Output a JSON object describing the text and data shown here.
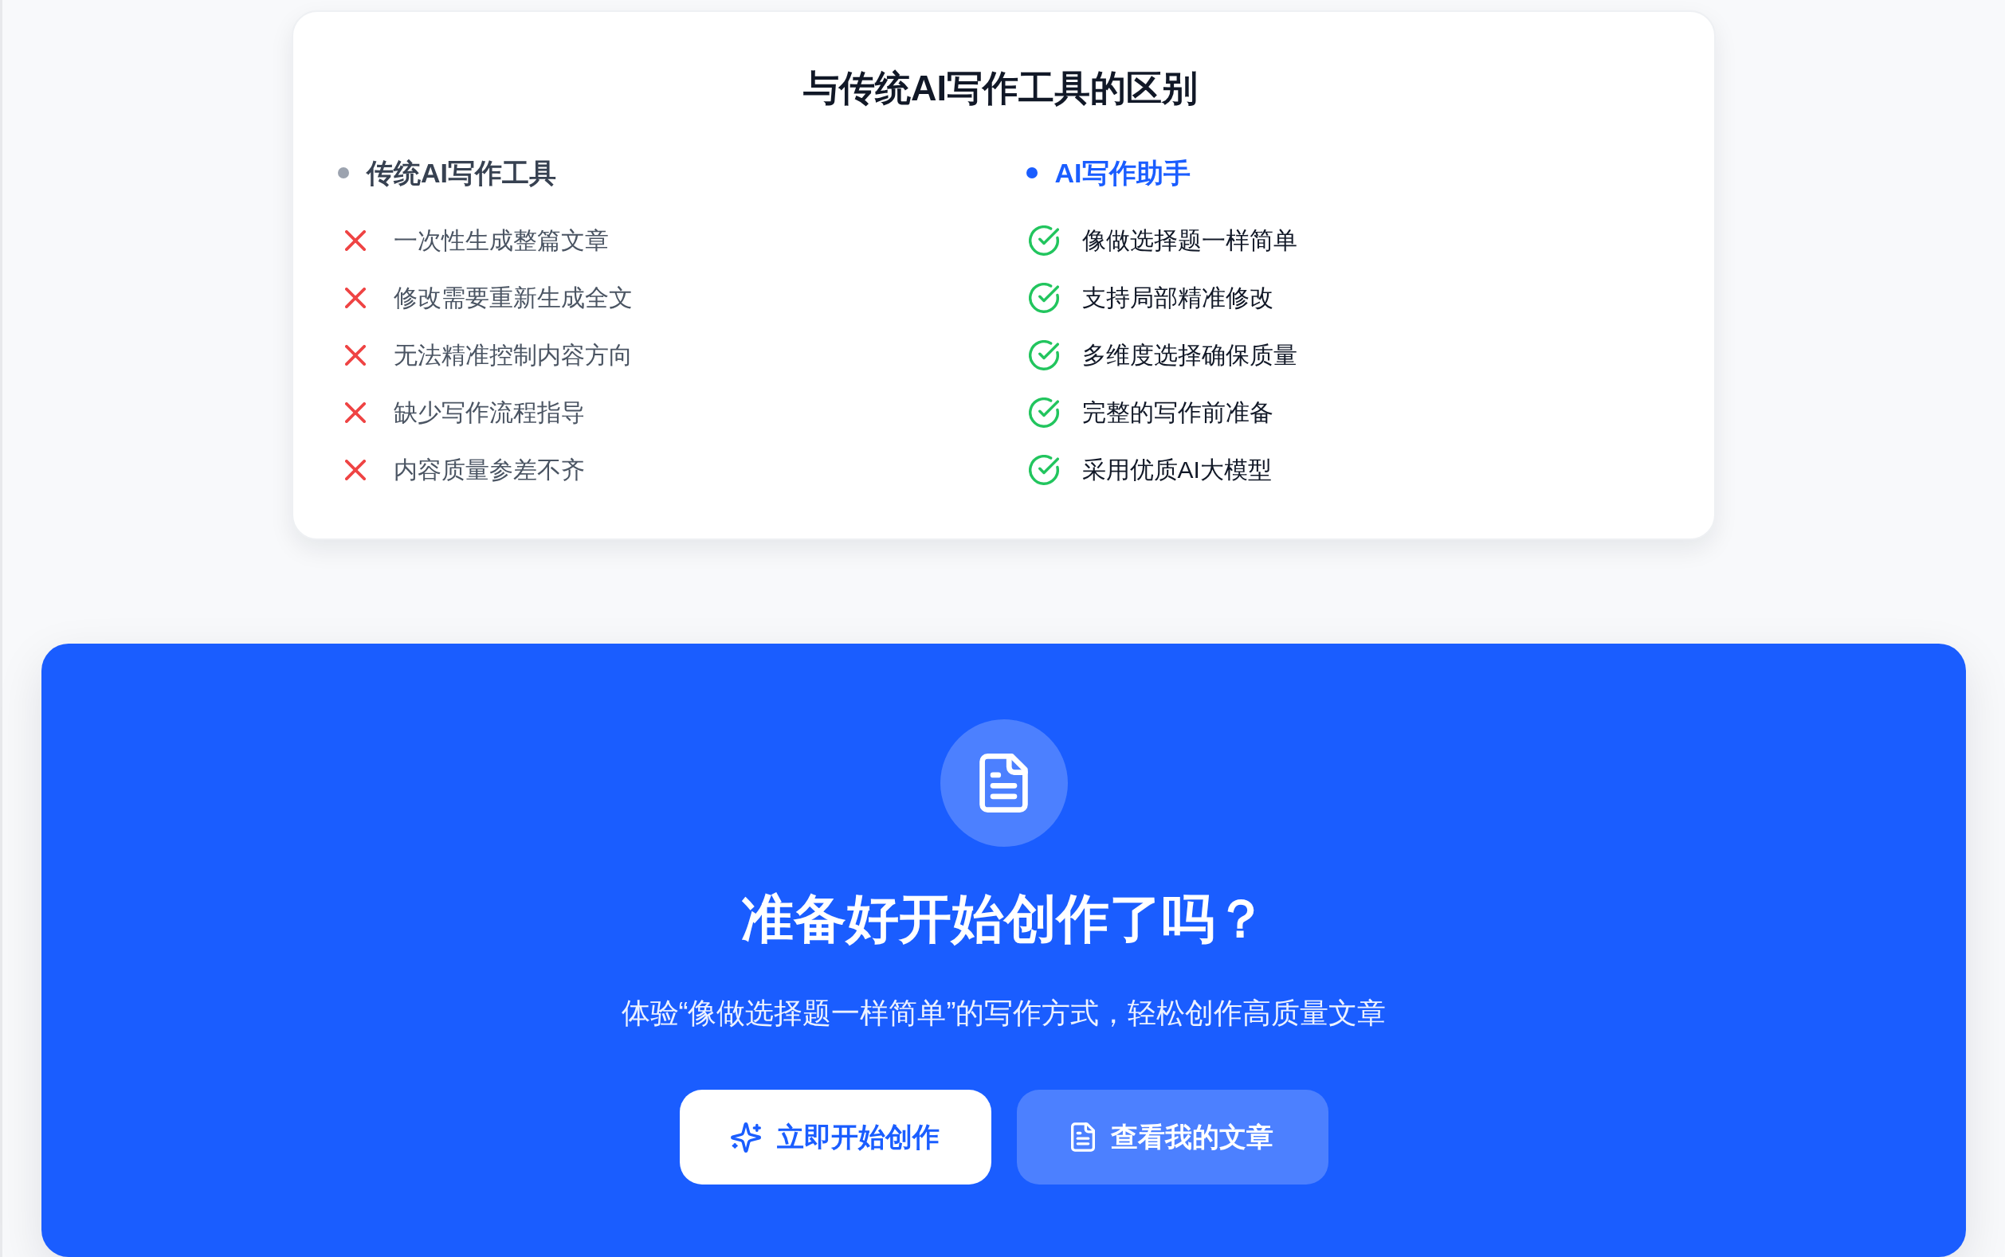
{
  "comparison": {
    "title": "与传统AI写作工具的区别",
    "columns": [
      {
        "kind": "traditional",
        "heading": "传统AI写作工具",
        "color": "#9ca3af",
        "items": [
          "一次性生成整篇文章",
          "修改需要重新生成全文",
          "无法精准控制内容方向",
          "缺少写作流程指导",
          "内容质量参差不齐"
        ]
      },
      {
        "kind": "assistant",
        "heading": "AI写作助手",
        "color": "#1a5dff",
        "items": [
          "像做选择题一样简单",
          "支持局部精准修改",
          "多维度选择确保质量",
          "完整的写作前准备",
          "采用优质AI大模型"
        ]
      }
    ]
  },
  "cta": {
    "title": "准备好开始创作了吗？",
    "subtitle": "体验“像做选择题一样简单”的写作方式，轻松创作高质量文章",
    "buttons": [
      {
        "kind": "primary",
        "label": "立即开始创作"
      },
      {
        "kind": "secondary",
        "label": "查看我的文章"
      }
    ]
  }
}
